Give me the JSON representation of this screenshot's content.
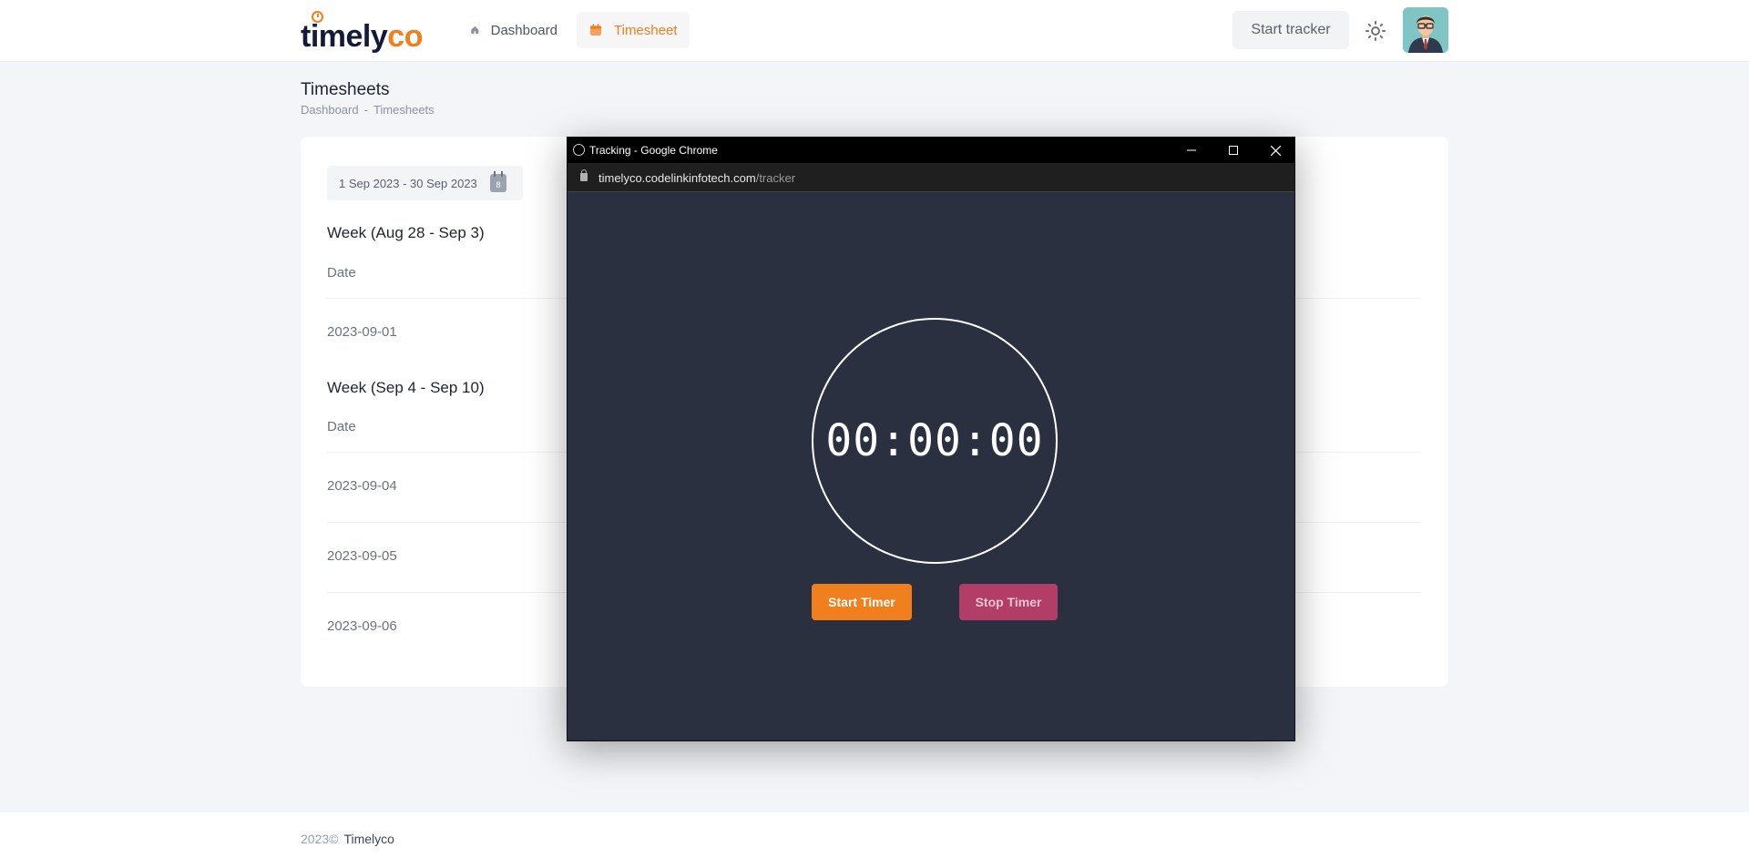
{
  "header": {
    "logo_text": "timelyco",
    "nav": [
      {
        "label": "Dashboard",
        "icon": "home-icon",
        "active": false
      },
      {
        "label": "Timesheet",
        "icon": "calendar-icon",
        "active": true
      }
    ],
    "start_tracker_label": "Start tracker",
    "theme_icon": "sun-icon",
    "avatar_icon": "user-avatar"
  },
  "page": {
    "title": "Timesheets",
    "breadcrumb": [
      "Dashboard",
      "Timesheets"
    ],
    "breadcrumb_sep": "-"
  },
  "card": {
    "date_range": "1 Sep 2023 - 30 Sep 2023",
    "date_range_icon_day": "8",
    "weeks": [
      {
        "title": "Week (Aug 28 - Sep 3)",
        "column": "Date",
        "dates": [
          "2023-09-01"
        ]
      },
      {
        "title": "Week (Sep 4 - Sep 10)",
        "column": "Date",
        "dates": [
          "2023-09-04",
          "2023-09-05",
          "2023-09-06"
        ]
      }
    ]
  },
  "footer": {
    "year": "2023©",
    "brand": "Timelyco"
  },
  "popup": {
    "window_title": "Tracking - Google Chrome",
    "url_host": "timelyco.codelinkinfotech.com",
    "url_path": "/tracker",
    "timer": "00:00:00",
    "start_label": "Start Timer",
    "stop_label": "Stop Timer"
  },
  "colors": {
    "accent": "#f07f1e",
    "stop": "#b23d66",
    "popup_bg": "#2b3041"
  }
}
